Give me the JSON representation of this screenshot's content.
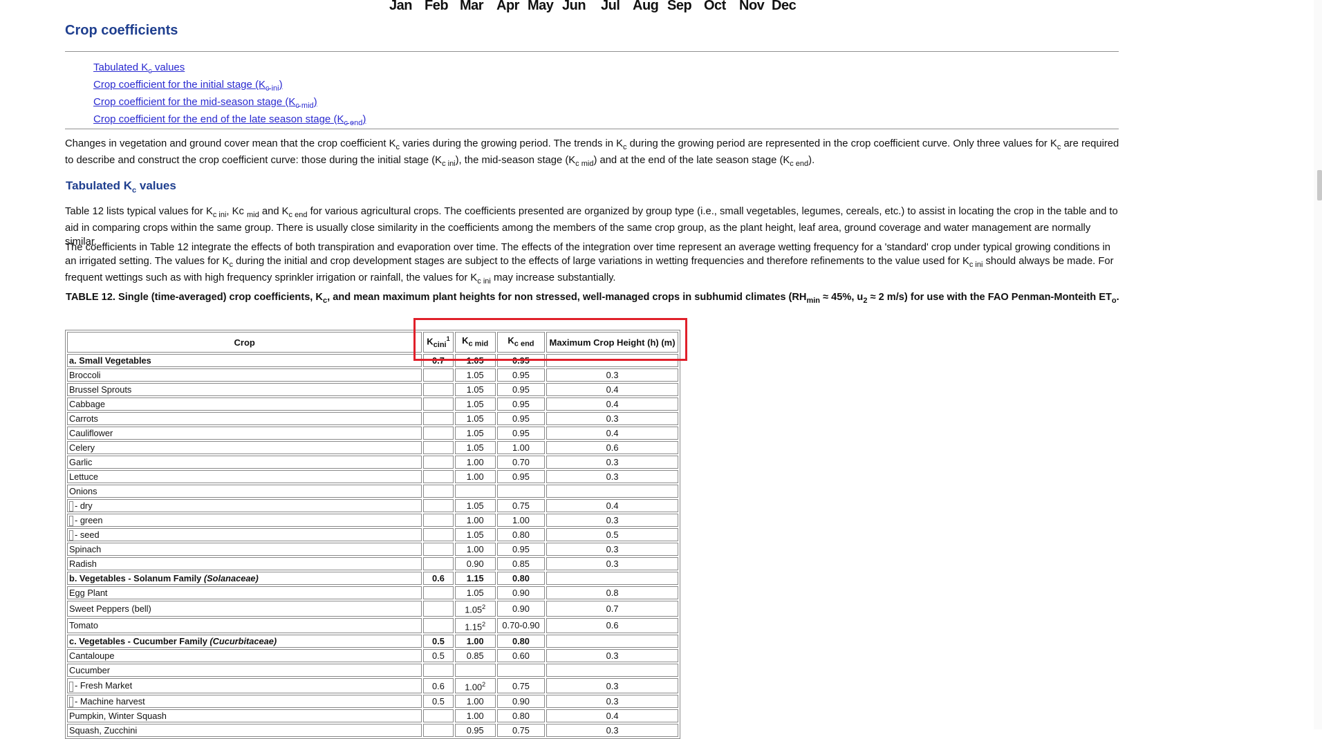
{
  "months": [
    "Jan",
    "Feb",
    "Mar",
    "Apr",
    "May",
    "Jun",
    "Jul",
    "Aug",
    "Sep",
    "Oct",
    "Nov",
    "Dec"
  ],
  "page_title": "Crop coefficients",
  "toc": [
    {
      "pre": "Tabulated K",
      "sub": "c",
      "post": " values"
    },
    {
      "pre": "Crop coefficient for the initial stage (K",
      "sub": "c ini",
      "post": ")"
    },
    {
      "pre": "Crop coefficient for the mid-season stage (K",
      "sub": "c mid",
      "post": ")"
    },
    {
      "pre": "Crop coefficient for the end of the late season stage (K",
      "sub": "c end",
      "post": ")"
    }
  ],
  "intro": {
    "t1": "Changes in vegetation and ground cover mean that the crop coefficient K",
    "s1": "c",
    "t2": " varies during the growing period. The trends in K",
    "s2": "c",
    "t3": " during the growing period are represented in the crop coefficient curve. Only three values for K",
    "s3": "c",
    "t4": " are required to describe and construct the crop coefficient curve: those during the initial stage (K",
    "s4": "c ini",
    "t5": "), the mid-season stage (K",
    "s5": "c mid",
    "t6": ") and at the end of the late season stage (K",
    "s6": "c end",
    "t7": ")."
  },
  "section": {
    "pre": "Tabulated K",
    "sub": "c",
    "post": " values"
  },
  "para1": {
    "t1": "Table 12 lists typical values for K",
    "s1": "c ini",
    "t2": ", Kc ",
    "s2": "mid",
    "t3": " and K",
    "s3": "c end",
    "t4": " for various agricultural crops. The coefficients presented are organized by group type (i.e., small vegetables, legumes, cereals, etc.) to assist in locating the crop in the table and to aid in comparing crops within the same group. There is usually close similarity in the coefficients among the members of the same crop group, as the plant height, leaf area, ground coverage and water management are normally similar."
  },
  "para2": {
    "t1": "The coefficients in Table 12 integrate the effects of both transpiration and evaporation over time. The effects of the integration over time represent an average wetting frequency for a 'standard' crop under typical growing conditions in an irrigated setting. The values for K",
    "s1": "c",
    "t2": " during the initial and crop development stages are subject to the effects of large variations in wetting frequencies and therefore refinements to the value used for K",
    "s2": "c ini",
    "t3": " should always be made. For frequent wettings such as with high frequency sprinkler irrigation or rainfall, the values for K",
    "s3": "c ini",
    "t4": " may increase substantially."
  },
  "caption": {
    "t1": "TABLE 12. Single (time-averaged) crop coefficients, K",
    "s1": "c",
    "t2": ", and mean maximum plant heights for non stressed, well-managed crops in subhumid climates (RH",
    "s2": "min",
    "t3": " ≈ 45%, u",
    "s3": "2",
    "t4": " ≈ 2 m/s) for use with the FAO Penman-Monteith ET",
    "s4": "o",
    "t5": "."
  },
  "table": {
    "headers": {
      "crop": "Crop",
      "kini_main": "K",
      "kini_sub": "cini",
      "kini_sup": "1",
      "kmid_main": "K",
      "kmid_sub": "c mid",
      "kend_main": "K",
      "kend_sub": "c end",
      "height": "Maximum Crop Height (h) (m)"
    },
    "rows": [
      {
        "crop": "a. Small Vegetables",
        "group": true,
        "kini": "0.7",
        "kmid": "1.05",
        "kend": "0.95",
        "h": ""
      },
      {
        "crop": "Broccoli",
        "kini": "",
        "kmid": "1.05",
        "kend": "0.95",
        "h": "0.3"
      },
      {
        "crop": "Brussel Sprouts",
        "kini": "",
        "kmid": "1.05",
        "kend": "0.95",
        "h": "0.4"
      },
      {
        "crop": "Cabbage",
        "kini": "",
        "kmid": "1.05",
        "kend": "0.95",
        "h": "0.4"
      },
      {
        "crop": "Carrots",
        "kini": "",
        "kmid": "1.05",
        "kend": "0.95",
        "h": "0.3"
      },
      {
        "crop": "Cauliflower",
        "kini": "",
        "kmid": "1.05",
        "kend": "0.95",
        "h": "0.4"
      },
      {
        "crop": "Celery",
        "kini": "",
        "kmid": "1.05",
        "kend": "1.00",
        "h": "0.6"
      },
      {
        "crop": "Garlic",
        "kini": "",
        "kmid": "1.00",
        "kend": "0.70",
        "h": "0.3"
      },
      {
        "crop": "Lettuce",
        "kini": "",
        "kmid": "1.00",
        "kend": "0.95",
        "h": "0.3"
      },
      {
        "crop": "Onions",
        "kini": "",
        "kmid": "",
        "kend": "",
        "h": ""
      },
      {
        "crop": "- dry",
        "indent": true,
        "kini": "",
        "kmid": "1.05",
        "kend": "0.75",
        "h": "0.4"
      },
      {
        "crop": "- green",
        "indent": true,
        "kini": "",
        "kmid": "1.00",
        "kend": "1.00",
        "h": "0.3"
      },
      {
        "crop": "- seed",
        "indent": true,
        "kini": "",
        "kmid": "1.05",
        "kend": "0.80",
        "h": "0.5"
      },
      {
        "crop": "Spinach",
        "kini": "",
        "kmid": "1.00",
        "kend": "0.95",
        "h": "0.3"
      },
      {
        "crop": "Radish",
        "kini": "",
        "kmid": "0.90",
        "kend": "0.85",
        "h": "0.3"
      },
      {
        "crop": "b. Vegetables - Solanum Family ",
        "crop_italic": "(Solanaceae)",
        "group": true,
        "kini": "0.6",
        "kmid": "1.15",
        "kend": "0.80",
        "h": ""
      },
      {
        "crop": "Egg Plant",
        "kini": "",
        "kmid": "1.05",
        "kend": "0.90",
        "h": "0.8"
      },
      {
        "crop": "Sweet Peppers (bell)",
        "kini": "",
        "kmid": "1.05",
        "kmid_sup": "2",
        "kend": "0.90",
        "h": "0.7"
      },
      {
        "crop": "Tomato",
        "kini": "",
        "kmid": "1.15",
        "kmid_sup": "2",
        "kend": "0.70-0.90",
        "h": "0.6"
      },
      {
        "crop": "c. Vegetables - Cucumber Family ",
        "crop_italic": "(Cucurbitaceae)",
        "group": true,
        "kini": "0.5",
        "kmid": "1.00",
        "kend": "0.80",
        "h": ""
      },
      {
        "crop": "Cantaloupe",
        "kini": "0.5",
        "kmid": "0.85",
        "kend": "0.60",
        "h": "0.3"
      },
      {
        "crop": "Cucumber",
        "kini": "",
        "kmid": "",
        "kend": "",
        "h": ""
      },
      {
        "crop": "- Fresh Market",
        "indent": true,
        "kini": "0.6",
        "kmid": "1.00",
        "kmid_sup": "2",
        "kend": "0.75",
        "h": "0.3"
      },
      {
        "crop": "- Machine harvest",
        "indent": true,
        "kini": "0.5",
        "kmid": "1.00",
        "kend": "0.90",
        "h": "0.3"
      },
      {
        "crop": "Pumpkin, Winter Squash",
        "kini": "",
        "kmid": "1.00",
        "kend": "0.80",
        "h": "0.4"
      },
      {
        "crop": "Squash, Zucchini",
        "kini": "",
        "kmid": "0.95",
        "kend": "0.75",
        "h": "0.3"
      }
    ]
  },
  "colors": {
    "heading": "#1f3f8f",
    "link": "#2a2ad0",
    "highlight": "#e0202a"
  }
}
